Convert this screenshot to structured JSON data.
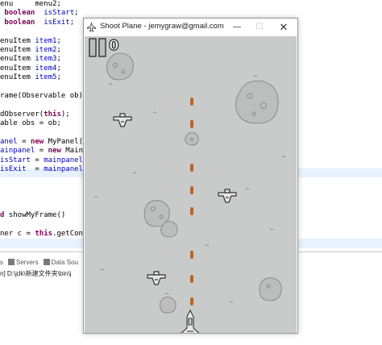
{
  "editor": {
    "lines": [
      {
        "segs": [
          {
            "t": "enu     menu2;",
            "c": ""
          }
        ]
      },
      {
        "segs": [
          {
            "t": " boolean",
            "c": "kw"
          },
          {
            "t": "  ",
            "c": ""
          },
          {
            "t": "isStart",
            "c": "fld"
          },
          {
            "t": ";",
            "c": ""
          }
        ]
      },
      {
        "segs": [
          {
            "t": " boolean",
            "c": "kw"
          },
          {
            "t": "  ",
            "c": ""
          },
          {
            "t": "isExit",
            "c": "fld"
          },
          {
            "t": ";",
            "c": ""
          }
        ]
      },
      {
        "segs": [
          {
            "t": "",
            "c": ""
          }
        ]
      },
      {
        "segs": [
          {
            "t": "enuItem ",
            "c": ""
          },
          {
            "t": "item1",
            "c": "fld"
          },
          {
            "t": ";     //",
            "c": ""
          }
        ]
      },
      {
        "segs": [
          {
            "t": "enuItem ",
            "c": ""
          },
          {
            "t": "item2",
            "c": "fld"
          },
          {
            "t": ";",
            "c": ""
          }
        ]
      },
      {
        "segs": [
          {
            "t": "enuItem ",
            "c": ""
          },
          {
            "t": "item3",
            "c": "fld"
          },
          {
            "t": ";",
            "c": ""
          }
        ]
      },
      {
        "segs": [
          {
            "t": "enuItem ",
            "c": ""
          },
          {
            "t": "item4",
            "c": "fld"
          },
          {
            "t": ";",
            "c": ""
          }
        ]
      },
      {
        "segs": [
          {
            "t": "enuItem ",
            "c": ""
          },
          {
            "t": "item5",
            "c": "fld"
          },
          {
            "t": ";",
            "c": ""
          }
        ]
      },
      {
        "segs": [
          {
            "t": "",
            "c": ""
          }
        ]
      },
      {
        "segs": [
          {
            "t": "rame(Observable ob)",
            "c": ""
          }
        ]
      },
      {
        "segs": [
          {
            "t": "",
            "c": ""
          }
        ]
      },
      {
        "segs": [
          {
            "t": "dObserver(",
            "c": ""
          },
          {
            "t": "this",
            "c": "kw"
          },
          {
            "t": ");",
            "c": ""
          }
        ]
      },
      {
        "segs": [
          {
            "t": "able obs = ob;",
            "c": ""
          }
        ]
      },
      {
        "segs": [
          {
            "t": "",
            "c": ""
          }
        ]
      },
      {
        "segs": [
          {
            "t": "anel",
            "c": "fld"
          },
          {
            "t": " = ",
            "c": ""
          },
          {
            "t": "new",
            "c": "kw"
          },
          {
            "t": " MyPanel()",
            "c": ""
          }
        ]
      },
      {
        "segs": [
          {
            "t": "ainpanel",
            "c": "fld"
          },
          {
            "t": " = ",
            "c": ""
          },
          {
            "t": "new",
            "c": "kw"
          },
          {
            "t": " MainP",
            "c": ""
          }
        ]
      },
      {
        "segs": [
          {
            "t": "isStart",
            "c": "fld"
          },
          {
            "t": " = ",
            "c": ""
          },
          {
            "t": "mainpanel",
            "c": "fld"
          },
          {
            "t": ".g",
            "c": ""
          }
        ]
      },
      {
        "segs": [
          {
            "t": "isExit",
            "c": "fld"
          },
          {
            "t": "  = ",
            "c": ""
          },
          {
            "t": "mainpanel",
            "c": "fld"
          },
          {
            "t": ".i",
            "c": ""
          }
        ]
      },
      {
        "segs": [
          {
            "t": "",
            "c": ""
          }
        ]
      },
      {
        "segs": [
          {
            "t": "",
            "c": ""
          }
        ]
      },
      {
        "segs": [
          {
            "t": "",
            "c": ""
          }
        ]
      },
      {
        "segs": [
          {
            "t": "",
            "c": ""
          }
        ]
      },
      {
        "segs": [
          {
            "t": "d",
            "c": "kw"
          },
          {
            "t": " showMyFrame()",
            "c": ""
          }
        ]
      },
      {
        "segs": [
          {
            "t": "",
            "c": ""
          }
        ]
      },
      {
        "segs": [
          {
            "t": "ner c = ",
            "c": ""
          },
          {
            "t": "this",
            "c": "kw"
          },
          {
            "t": ".getCont",
            "c": ""
          }
        ]
      }
    ]
  },
  "panel": {
    "tabs": [
      {
        "label": "s"
      },
      {
        "label": "Servers"
      },
      {
        "label": "Data Sou"
      }
    ],
    "console_text": "n] D:\\jdk\\新建文件夹\\bin\\j"
  },
  "window": {
    "title": "Shoot Plane - jemygraw@gmail.com",
    "minimize_glyph": "—",
    "maximize_glyph": "☐",
    "close_glyph": "✕"
  },
  "game": {
    "score": "0",
    "pause_icon": "pause-icon",
    "colors": {
      "background": "#c9cbca",
      "bullet": "#b8642a",
      "outline": "#333333",
      "stone": "#bcbebd"
    }
  }
}
